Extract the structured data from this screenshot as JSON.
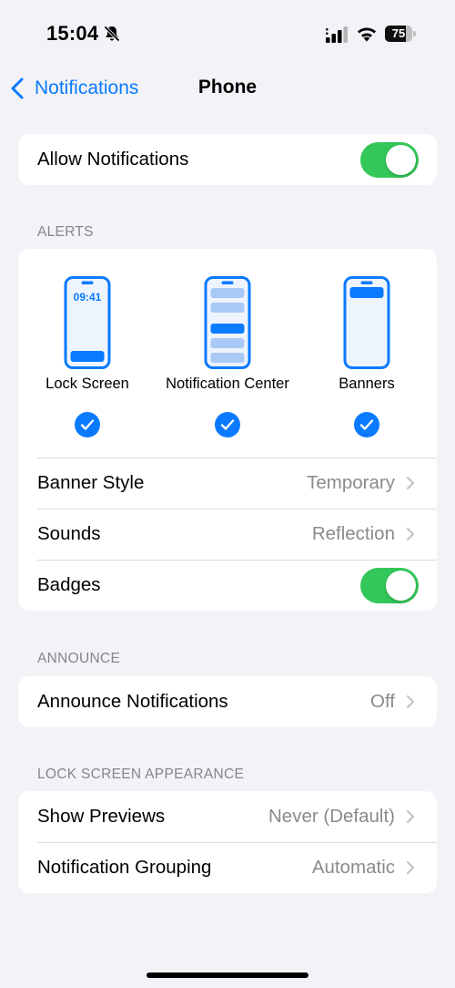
{
  "status": {
    "time": "15:04",
    "battery": "75",
    "battery_level": 0.75
  },
  "nav": {
    "back_label": "Notifications",
    "title": "Phone"
  },
  "allow": {
    "label": "Allow Notifications",
    "on": true
  },
  "alerts": {
    "header": "ALERTS",
    "styles": [
      {
        "label": "Lock Screen",
        "checked": true,
        "clock": "09:41"
      },
      {
        "label": "Notification Center",
        "checked": true
      },
      {
        "label": "Banners",
        "checked": true
      }
    ],
    "rows": [
      {
        "label": "Banner Style",
        "value": "Temporary"
      },
      {
        "label": "Sounds",
        "value": "Reflection"
      },
      {
        "label": "Badges",
        "on": true
      }
    ]
  },
  "announce": {
    "header": "ANNOUNCE",
    "row": {
      "label": "Announce Notifications",
      "value": "Off"
    }
  },
  "lock_screen": {
    "header": "LOCK SCREEN APPEARANCE",
    "rows": [
      {
        "label": "Show Previews",
        "value": "Never (Default)"
      },
      {
        "label": "Notification Grouping",
        "value": "Automatic"
      }
    ]
  },
  "colors": {
    "accent": "#0a7aff",
    "toggle_on": "#34c759",
    "background": "#f2f2f7",
    "secondary_text": "#8a8a8e"
  },
  "icons": [
    "bell-slash-icon",
    "cellular-signal-icon",
    "wifi-icon",
    "battery-icon",
    "chevron-left-icon",
    "chevron-right-icon",
    "checkmark-circle-icon"
  ]
}
